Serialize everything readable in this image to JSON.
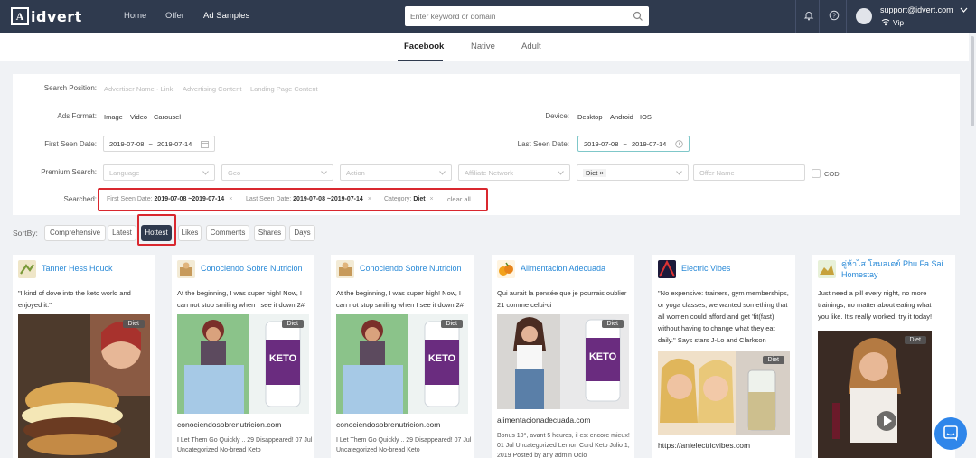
{
  "nav": {
    "logo_mark": "A",
    "logo_text": "idvert",
    "items": [
      "Home",
      "Offer",
      "Ad Samples"
    ],
    "search_placeholder": "Enter keyword or domain",
    "user_email": "support@idvert.com",
    "user_level": "Vip"
  },
  "platform_tabs": [
    "Facebook",
    "Native",
    "Adult"
  ],
  "filters": {
    "search_position_label": "Search Position:",
    "search_position_options": [
      "Advertiser Name · Link",
      "Advertising Content",
      "Landing Page Content"
    ],
    "ads_format_label": "Ads Format:",
    "ads_format_options": [
      "Image",
      "Video",
      "Carousel"
    ],
    "device_label": "Device:",
    "device_options": [
      "Desktop",
      "Android",
      "IOS"
    ],
    "first_seen_label": "First Seen Date:",
    "first_seen_start": "2019-07-08",
    "first_seen_end": "2019-07-14",
    "last_seen_label": "Last Seen Date:",
    "last_seen_start": "2019-07-08",
    "last_seen_end": "2019-07-14",
    "date_separator": "~",
    "premium_label": "Premium Search:",
    "premium_selects": [
      "Language",
      "Geo",
      "Action",
      "Affiliate Network",
      "Diet ×",
      ""
    ],
    "offer_name_placeholder": "Offer Name",
    "cod_label": "COD",
    "searched_label": "Searched:",
    "chips": [
      {
        "label": "First Seen Date:",
        "value": "2019-07-08 ~2019-07-14"
      },
      {
        "label": "Last Seen Date:",
        "value": "2019-07-08 ~2019-07-14"
      },
      {
        "label": "Category:",
        "value": "Diet"
      }
    ],
    "chip_close": "×",
    "clear_all": "clear all"
  },
  "sort": {
    "label": "SortBy:",
    "options": [
      "Comprehensive",
      "Latest",
      "Hottest",
      "Likes",
      "Comments",
      "Shares",
      "Days"
    ],
    "active": "Hottest"
  },
  "cards": [
    {
      "name": "Tanner Hess Houck",
      "text": "\"I kind of dove into the keto world and enjoyed it.\"",
      "tag": "Diet",
      "url": "",
      "sub": ""
    },
    {
      "name": "Conociendo Sobre Nutricion",
      "text": "At the beginning, I was super high! Now, I can not stop smiling when I see it down 2#",
      "tag": "Diet",
      "url": "conociendosobrenutricion.com",
      "sub": "I Let Them Go Quickly .. 29 Disappeared! 07 Jul Uncategorized No-bread Keto"
    },
    {
      "name": "Conociendo Sobre Nutricion",
      "text": "At the beginning, I was super high! Now, I can not stop smiling when I see it down 2#",
      "tag": "Diet",
      "url": "conociendosobrenutricion.com",
      "sub": "I Let Them Go Quickly .. 29 Disappeared! 07 Jul Uncategorized No-bread Keto"
    },
    {
      "name": "Alimentacion Adecuada",
      "text": "Qui aurait la pensée que je pourrais oublier 21 comme celui-ci",
      "tag": "Diet",
      "url": "alimentacionadecuada.com",
      "sub": "Bonus 10°, avant 5 heures, il est encore mieux! 01 Jul Uncategorized Lemon Curd Keto Julio 1, 2019 Posted by any admin Ocio"
    },
    {
      "name": "Electric Vibes",
      "text": "\"No expensive: trainers, gym memberships, or yoga classes, we wanted something that all women could afford and get 'fit(fast) without having to change what they eat daily.\" Says stars J-Lo and Clarkson",
      "tag": "Diet",
      "url": "https://anielectricvibes.com",
      "sub": ""
    },
    {
      "name": "คู่ห้าไส โฮมสเตย์ Phu Fa Sai Homestay",
      "text": "Just need a pill every night, no more trainings, no matter about eating what you like. It's really worked, try it today!",
      "tag": "Diet",
      "url": "",
      "sub": ""
    }
  ],
  "colors": {
    "nav_bg": "#2f3a4e",
    "link": "#2a8ad7",
    "highlight": "#d9282f",
    "chat": "#2f86ea"
  }
}
